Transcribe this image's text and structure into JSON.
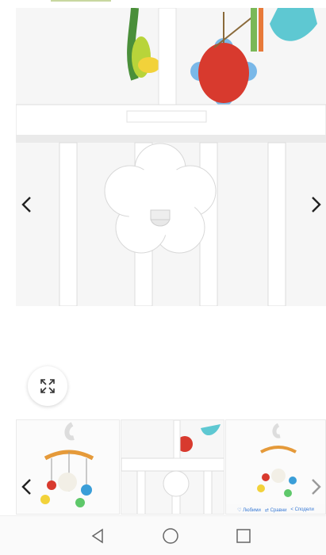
{
  "gallery": {
    "prev_icon": "chevron-left-icon",
    "next_icon": "chevron-right-icon",
    "zoom_icon": "expand-icon",
    "thumbnails": [
      {
        "subject": "baby crib mobile with hanging toys"
      },
      {
        "subject": "crib mount clamp close-up"
      },
      {
        "subject": "crib mobile product shot"
      }
    ],
    "thumb_actions": {
      "favorite_label": "Любими",
      "compare_label": "Сравни",
      "share_label": "Сподели"
    }
  },
  "system_nav": {
    "back_icon": "triangle-back-icon",
    "home_icon": "circle-home-icon",
    "recents_icon": "square-recents-icon"
  }
}
